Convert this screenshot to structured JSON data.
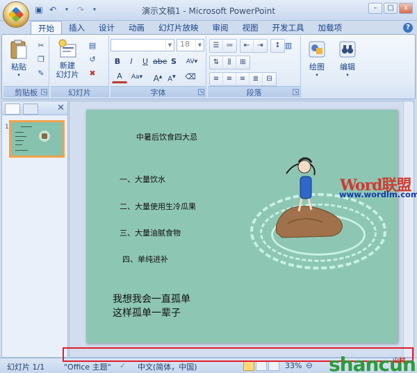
{
  "window": {
    "title": "演示文稿1 - Microsoft PowerPoint",
    "controls": [
      "–",
      "□",
      "x"
    ]
  },
  "quick_access": {
    "items": [
      "save-icon",
      "undo-icon",
      "redo-icon",
      "customize-icon"
    ]
  },
  "ribbon": {
    "tabs": [
      "开始",
      "插入",
      "设计",
      "动画",
      "幻灯片放映",
      "审阅",
      "视图",
      "开发工具",
      "加载项"
    ],
    "active_tab": "开始",
    "groups": {
      "clipboard": {
        "label": "剪贴板",
        "paste": "粘贴"
      },
      "slides": {
        "label": "幻灯片",
        "new_slide": "新建\n幻灯片"
      },
      "font": {
        "label": "字体",
        "font_name": "",
        "font_size": "18"
      },
      "paragraph": {
        "label": "段落"
      },
      "drawing": {
        "label": "绘图"
      },
      "editing": {
        "label": "编辑"
      }
    }
  },
  "slide": {
    "title": "中暑后饮食四大忌",
    "items": [
      "一、大量饮水",
      "二、大量使用生冷瓜果",
      "三、大量油腻食物",
      "四、单纯进补"
    ],
    "lines": [
      "我想我会一直孤单",
      "这样孤单一辈子"
    ],
    "background_color": "#8ec6b4"
  },
  "thumbnail": {
    "number": "1"
  },
  "status": {
    "slide_count": "幻灯片 1/1",
    "theme": "\"Office 主题\"",
    "language": "中文(简体，中国)",
    "zoom": "33%"
  },
  "watermarks": {
    "site_name": "Word联盟",
    "site_url": "www.wordlm.com",
    "brand": "shancun",
    "brand_sub": "山村"
  }
}
